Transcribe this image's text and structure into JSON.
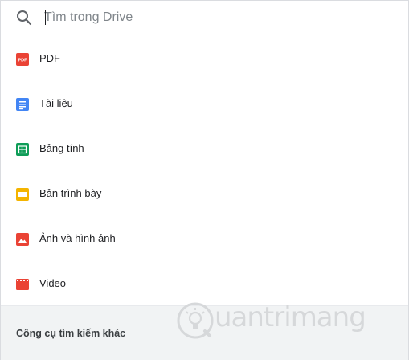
{
  "search": {
    "placeholder": "Tìm trong Drive",
    "value": ""
  },
  "types": [
    {
      "label": "PDF",
      "icon": "pdf-icon",
      "color": "#ea4335"
    },
    {
      "label": "Tài liệu",
      "icon": "docs-icon",
      "color": "#4285f4"
    },
    {
      "label": "Bảng tính",
      "icon": "sheets-icon",
      "color": "#0f9d58"
    },
    {
      "label": "Bản trình bày",
      "icon": "slides-icon",
      "color": "#f4b400"
    },
    {
      "label": "Ảnh và hình ảnh",
      "icon": "image-icon",
      "color": "#ea4335"
    },
    {
      "label": "Video",
      "icon": "video-icon",
      "color": "#ea4335"
    }
  ],
  "footer": {
    "label": "Công cụ tìm kiếm khác"
  },
  "watermark": {
    "text": "uantrimang"
  }
}
